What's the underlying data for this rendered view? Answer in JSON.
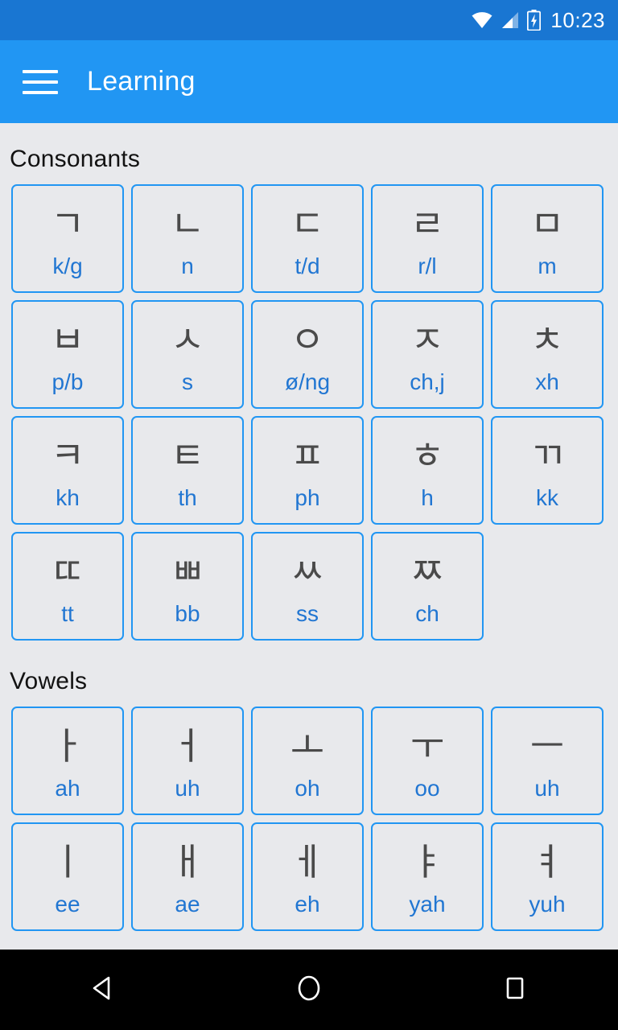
{
  "statusbar": {
    "time": "10:23",
    "icons": [
      "wifi-icon",
      "signal-icon",
      "battery-charging-icon"
    ]
  },
  "appbar": {
    "menu_icon": "hamburger-menu-icon",
    "title": "Learning",
    "background_color": "#2196F3"
  },
  "theme": {
    "accent": "#2196F3",
    "status_bar": "#1976D2",
    "page_background": "#E8E9EC",
    "glyph_color": "#4A4A4A",
    "roman_color": "#2176D2",
    "heading_color": "#121212"
  },
  "sections": [
    {
      "title": "Consonants",
      "tiles": [
        {
          "glyph": "ㄱ",
          "roman": "k/g"
        },
        {
          "glyph": "ㄴ",
          "roman": "n"
        },
        {
          "glyph": "ㄷ",
          "roman": "t/d"
        },
        {
          "glyph": "ㄹ",
          "roman": "r/l"
        },
        {
          "glyph": "ㅁ",
          "roman": "m"
        },
        {
          "glyph": "ㅂ",
          "roman": "p/b"
        },
        {
          "glyph": "ㅅ",
          "roman": "s"
        },
        {
          "glyph": "ㅇ",
          "roman": "ø/ng"
        },
        {
          "glyph": "ㅈ",
          "roman": "ch,j"
        },
        {
          "glyph": "ㅊ",
          "roman": "xh"
        },
        {
          "glyph": "ㅋ",
          "roman": "kh"
        },
        {
          "glyph": "ㅌ",
          "roman": "th"
        },
        {
          "glyph": "ㅍ",
          "roman": "ph"
        },
        {
          "glyph": "ㅎ",
          "roman": "h"
        },
        {
          "glyph": "ㄲ",
          "roman": "kk"
        },
        {
          "glyph": "ㄸ",
          "roman": "tt"
        },
        {
          "glyph": "ㅃ",
          "roman": "bb"
        },
        {
          "glyph": "ㅆ",
          "roman": "ss"
        },
        {
          "glyph": "ㅉ",
          "roman": "ch"
        }
      ]
    },
    {
      "title": "Vowels",
      "tiles": [
        {
          "glyph": "ㅏ",
          "roman": "ah"
        },
        {
          "glyph": "ㅓ",
          "roman": "uh"
        },
        {
          "glyph": "ㅗ",
          "roman": "oh"
        },
        {
          "glyph": "ㅜ",
          "roman": "oo"
        },
        {
          "glyph": "ㅡ",
          "roman": "uh"
        },
        {
          "glyph": "ㅣ",
          "roman": "ee"
        },
        {
          "glyph": "ㅐ",
          "roman": "ae"
        },
        {
          "glyph": "ㅔ",
          "roman": "eh"
        },
        {
          "glyph": "ㅑ",
          "roman": "yah"
        },
        {
          "glyph": "ㅕ",
          "roman": "yuh"
        }
      ]
    }
  ],
  "navbar": {
    "buttons": [
      {
        "name": "back-button",
        "icon": "back-triangle-icon"
      },
      {
        "name": "home-button",
        "icon": "home-circle-icon"
      },
      {
        "name": "recents-button",
        "icon": "recents-square-icon"
      }
    ]
  }
}
